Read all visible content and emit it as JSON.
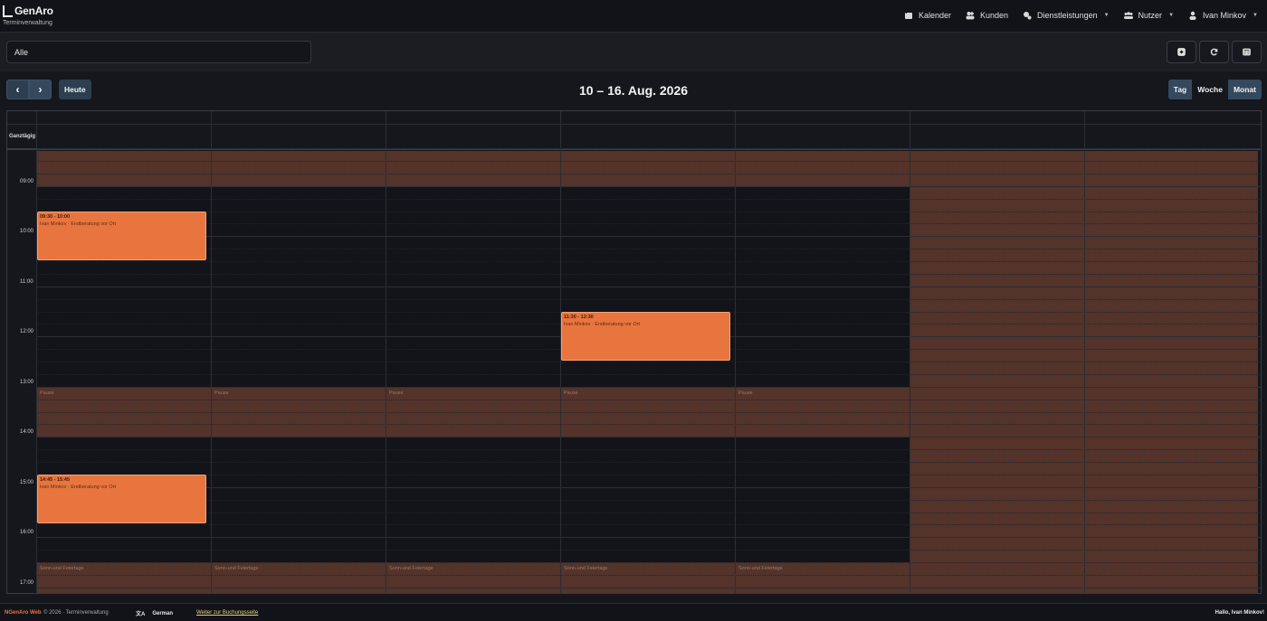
{
  "app": {
    "brand": "GenAro",
    "subtitle": "Terminverwaltung"
  },
  "nav": {
    "items": [
      {
        "label": "Kalender",
        "icon": "calendar-icon",
        "caret": false
      },
      {
        "label": "Kunden",
        "icon": "users-icon",
        "caret": false
      },
      {
        "label": "Dienstleistungen",
        "icon": "services-icon",
        "caret": true
      },
      {
        "label": "Nutzer",
        "icon": "team-icon",
        "caret": true
      },
      {
        "label": "Ivan Minkov",
        "icon": "user-icon",
        "caret": true
      }
    ]
  },
  "filter": {
    "selected": "Alle"
  },
  "toolbar": {
    "prev": "‹",
    "next": "›",
    "today": "Heute",
    "title": "10 – 16. Aug. 2026",
    "views": [
      {
        "label": "Tag",
        "active": true
      },
      {
        "label": "Woche",
        "active": false
      },
      {
        "label": "Monat",
        "active": true
      }
    ]
  },
  "calendar": {
    "allday_label": "Ganztägig",
    "hours": [
      "09:00",
      "10:00",
      "11:00",
      "12:00",
      "13:00",
      "14:00",
      "15:00",
      "16:00",
      "17:00"
    ],
    "pause_label": "Pause",
    "weekend_label": "Sonn-und Feiertage",
    "events": [
      {
        "day": 0,
        "start": 9.5,
        "end": 10.5,
        "time": "09:30 - 10:00",
        "title": "Ivan Minkov · Erstberatung vor Ort"
      },
      {
        "day": 3,
        "start": 11.5,
        "end": 12.5,
        "time": "11:30 - 12:30",
        "title": "Ivan Minkov · Erstberatung vor Ort"
      },
      {
        "day": 0,
        "start": 14.75,
        "end": 15.75,
        "time": "14:45 - 15:45",
        "title": "Ivan Minkov · Erstberatung vor Ort"
      }
    ]
  },
  "footer": {
    "brand": "NGenAro Web",
    "copyright": "© 2026 · Terminverwaltung",
    "language": "German",
    "booking_link": "Weiter zur Buchungsseite",
    "greeting": "Hallo, Ivan Minkov!"
  },
  "colors": {
    "event": "#e8753e",
    "closed": "#53332a",
    "button": "#2c3e50"
  }
}
